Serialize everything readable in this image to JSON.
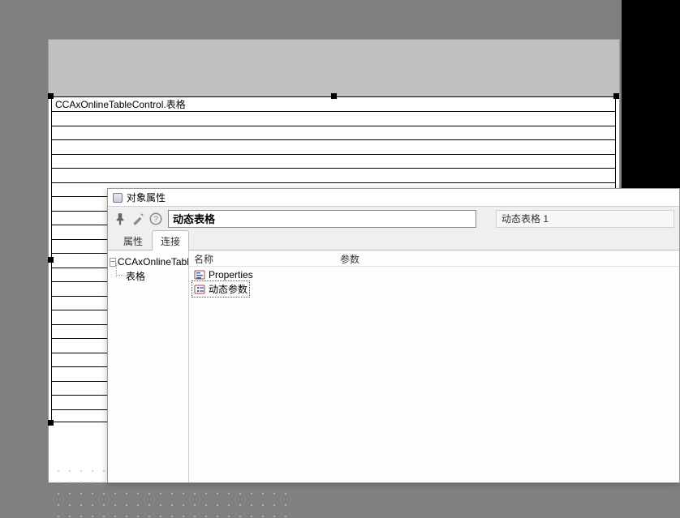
{
  "canvas": {
    "control_title": "CCAxOnlineTableControl.表格"
  },
  "dialog": {
    "title": "对象属性",
    "object_name": "动态表格",
    "object_id": "动态表格 1",
    "tabs": {
      "properties": "属性",
      "connections": "连接"
    },
    "tree": {
      "root": "CCAxOnlineTableControl",
      "child": "表格"
    },
    "list": {
      "columns": {
        "name": "名称",
        "param": "参数"
      },
      "items": [
        {
          "label": "Properties",
          "selected": false
        },
        {
          "label": "动态参数",
          "selected": true
        }
      ]
    }
  }
}
